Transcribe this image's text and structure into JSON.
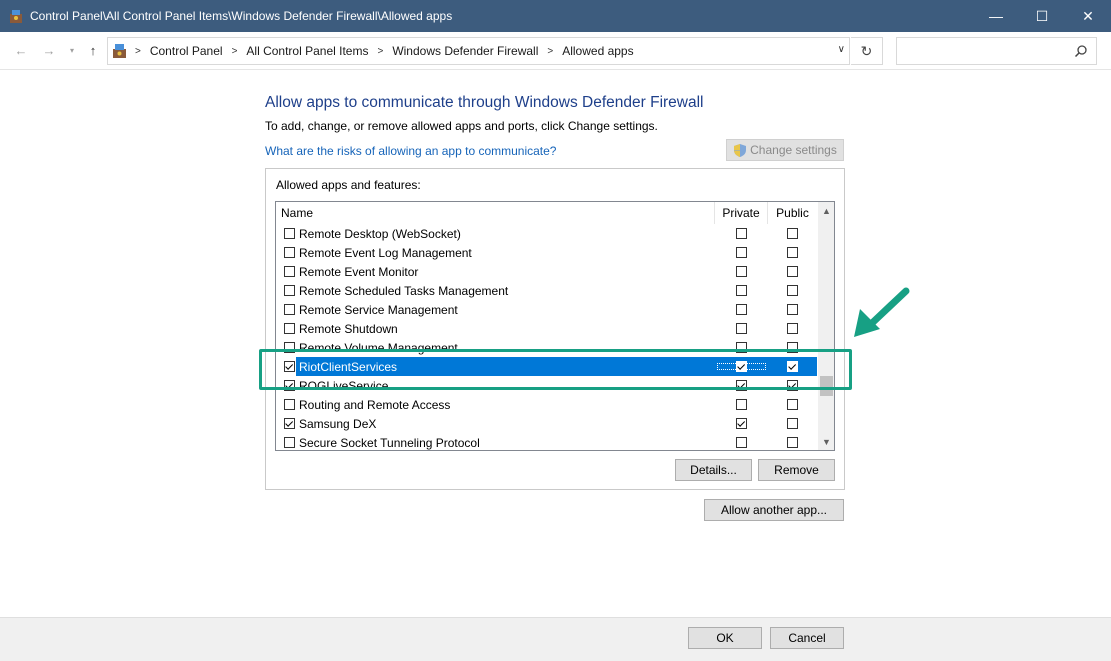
{
  "window": {
    "title": "Control Panel\\All Control Panel Items\\Windows Defender Firewall\\Allowed apps",
    "app_icon": "control-panel-icon",
    "controls": {
      "minimize": "—",
      "maximize": "☐",
      "close": "✕"
    }
  },
  "address_bar": {
    "breadcrumbs": [
      "Control Panel",
      "All Control Panel Items",
      "Windows Defender Firewall",
      "Allowed apps"
    ],
    "search_placeholder": ""
  },
  "main": {
    "heading": "Allow apps to communicate through Windows Defender Firewall",
    "subtext": "To add, change, or remove allowed apps and ports, click Change settings.",
    "risk_link": "What are the risks of allowing an app to communicate?",
    "change_settings_label": "Change settings",
    "group_label": "Allowed apps and features:",
    "columns": {
      "name": "Name",
      "private": "Private",
      "public": "Public"
    },
    "rows": [
      {
        "name": "Remote Desktop (WebSocket)",
        "enabled": false,
        "private": false,
        "public": false,
        "selected": false
      },
      {
        "name": "Remote Event Log Management",
        "enabled": false,
        "private": false,
        "public": false,
        "selected": false
      },
      {
        "name": "Remote Event Monitor",
        "enabled": false,
        "private": false,
        "public": false,
        "selected": false
      },
      {
        "name": "Remote Scheduled Tasks Management",
        "enabled": false,
        "private": false,
        "public": false,
        "selected": false
      },
      {
        "name": "Remote Service Management",
        "enabled": false,
        "private": false,
        "public": false,
        "selected": false
      },
      {
        "name": "Remote Shutdown",
        "enabled": false,
        "private": false,
        "public": false,
        "selected": false
      },
      {
        "name": "Remote Volume Management",
        "enabled": false,
        "private": false,
        "public": false,
        "selected": false
      },
      {
        "name": "RiotClientServices",
        "enabled": true,
        "private": true,
        "public": true,
        "selected": true
      },
      {
        "name": "ROGLiveService",
        "enabled": true,
        "private": true,
        "public": true,
        "selected": false
      },
      {
        "name": "Routing and Remote Access",
        "enabled": false,
        "private": false,
        "public": false,
        "selected": false
      },
      {
        "name": "Samsung DeX",
        "enabled": true,
        "private": true,
        "public": false,
        "selected": false
      },
      {
        "name": "Secure Socket Tunneling Protocol",
        "enabled": false,
        "private": false,
        "public": false,
        "selected": false
      }
    ],
    "details_label": "Details...",
    "remove_label": "Remove",
    "allow_another_label": "Allow another app..."
  },
  "footer": {
    "ok_label": "OK",
    "cancel_label": "Cancel"
  },
  "colors": {
    "titlebar": "#3d5c7e",
    "selection": "#0078d7",
    "heading": "#1e3f8a",
    "link": "#1664b9",
    "annotation": "#17a084"
  }
}
